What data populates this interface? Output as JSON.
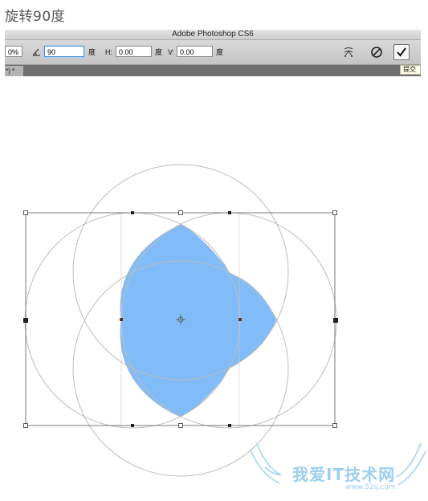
{
  "page_heading": "旋转90度",
  "app": {
    "title": "Adobe Photoshop CS6"
  },
  "options_bar": {
    "zoom_value": "0%",
    "angle_value": "90",
    "angle_unit": "度",
    "h_label": "H:",
    "h_value": "0.00",
    "h_unit": "度",
    "v_label": "V:",
    "v_value": "0.00",
    "v_unit": "度",
    "warp_icon": "warp-mode-icon",
    "cancel_icon": "cancel-icon",
    "commit_icon": "commit-checkmark-icon"
  },
  "document_tab": {
    "label": "*) *"
  },
  "tooltip": {
    "text": "提交"
  },
  "canvas": {
    "fill_color": "#82bcf8",
    "circle_stroke": "#bcbcbc"
  },
  "watermark": {
    "text": "我爱IT技术网",
    "url": "www.52ij.com"
  }
}
